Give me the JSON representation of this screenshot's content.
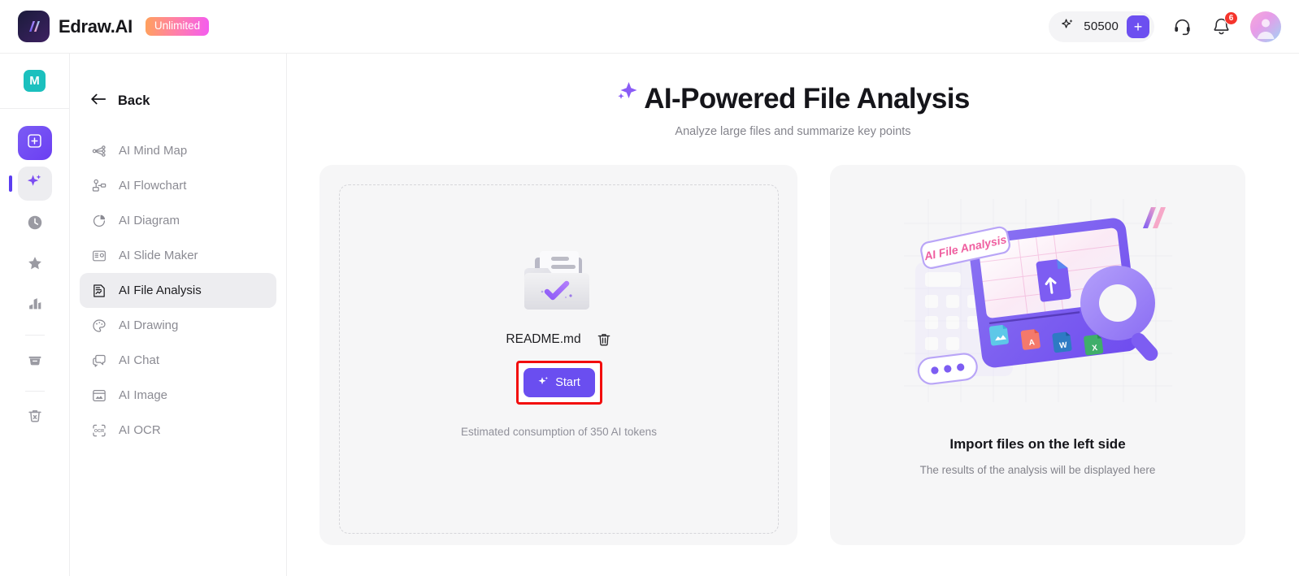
{
  "topbar": {
    "brand_name": "Edraw.AI",
    "plan_badge": "Unlimited",
    "token_count": "50500",
    "token_plus_label": "+",
    "notification_badge": "6",
    "icons": {
      "sparkle": "sparkle-icon",
      "plus": "plus-icon",
      "support": "headset-icon",
      "bell": "bell-icon",
      "avatar": "user-avatar"
    }
  },
  "rail": {
    "workspace_initial": "M",
    "items": [
      {
        "name": "new-document",
        "icon": "plus-square-icon",
        "state": "primary"
      },
      {
        "name": "ai-tools",
        "icon": "sparkle-icon",
        "state": "active"
      },
      {
        "name": "recent",
        "icon": "clock-icon",
        "state": "normal"
      },
      {
        "name": "favorites",
        "icon": "star-icon",
        "state": "normal"
      },
      {
        "name": "templates",
        "icon": "templates-icon",
        "state": "normal"
      },
      {
        "name": "archive",
        "icon": "folder-icon",
        "state": "normal"
      },
      {
        "name": "trash",
        "icon": "trash-icon",
        "state": "normal"
      }
    ]
  },
  "menu": {
    "back_label": "Back",
    "items": [
      {
        "label": "AI Mind Map",
        "icon": "mindmap-icon",
        "selected": false
      },
      {
        "label": "AI Flowchart",
        "icon": "flowchart-icon",
        "selected": false
      },
      {
        "label": "AI Diagram",
        "icon": "piechart-icon",
        "selected": false
      },
      {
        "label": "AI Slide Maker",
        "icon": "slide-icon",
        "selected": false
      },
      {
        "label": "AI File Analysis",
        "icon": "file-analysis-icon",
        "selected": true
      },
      {
        "label": "AI Drawing",
        "icon": "palette-icon",
        "selected": false
      },
      {
        "label": "AI Chat",
        "icon": "chat-icon",
        "selected": false
      },
      {
        "label": "AI Image",
        "icon": "image-icon",
        "selected": false
      },
      {
        "label": "AI OCR",
        "icon": "ocr-icon",
        "selected": false
      }
    ]
  },
  "main": {
    "title": "AI-Powered File Analysis",
    "subtitle": "Analyze large files and summarize key points",
    "upload_card": {
      "file_name": "README.md",
      "delete_icon": "trash-icon",
      "folder_icon": "folder-check-icon",
      "start_button": "Start",
      "start_icon": "sparkle-icon",
      "token_note": "Estimated consumption of 350 AI tokens",
      "highlight_color": "#f20d0d"
    },
    "result_card": {
      "illustration_label": "AI File Analysis",
      "title": "Import files on the left side",
      "subtitle": "The results of the analysis will be displayed here"
    }
  },
  "colors": {
    "accent_purple": "#6a4ef0",
    "rail_teal": "#1bc0be",
    "badge_red": "#f5342c",
    "highlight_red": "#f20d0d",
    "panel_bg": "#f6f6f7"
  }
}
